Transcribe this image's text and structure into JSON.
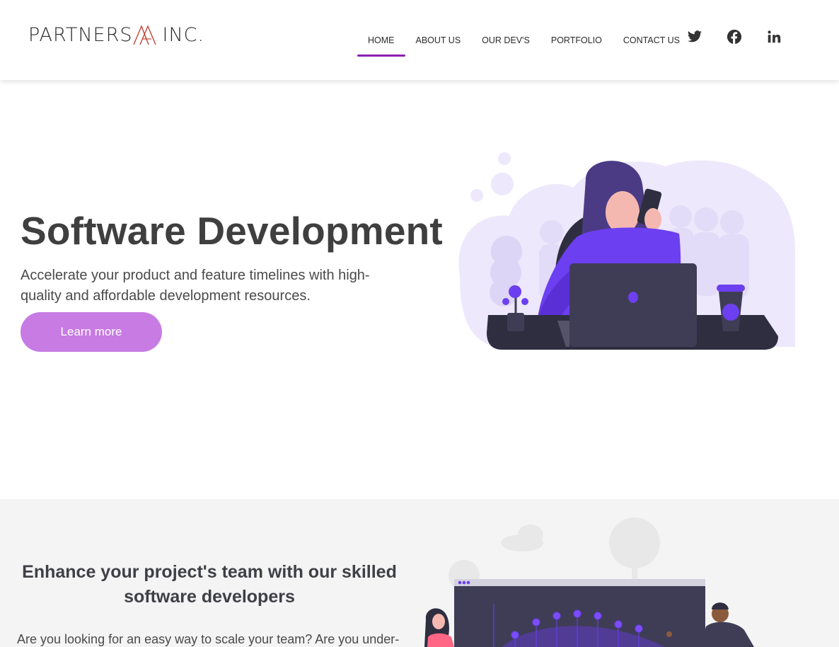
{
  "logo": {
    "left": "PARTNERS",
    "right": "INC."
  },
  "nav": {
    "items": [
      {
        "label": "HOME",
        "active": true
      },
      {
        "label": "ABOUT US",
        "active": false
      },
      {
        "label": "OUR DEV'S",
        "active": false
      },
      {
        "label": "PORTFOLIO",
        "active": false
      },
      {
        "label": "CONTACT US",
        "active": false
      }
    ],
    "social": [
      "twitter-icon",
      "facebook-icon",
      "linkedin-icon"
    ]
  },
  "hero": {
    "title": "Software Development",
    "subtitle": "Accelerate your product and feature timelines with high-quality and affordable development resources.",
    "button_label": "Learn more"
  },
  "section2": {
    "heading": "Enhance your project's team with our skilled software developers",
    "text": "Are you looking for an easy way to scale your team? Are you under-"
  },
  "colors": {
    "accent": "#8e1fb3",
    "button": "#c77be3",
    "illustration_purple": "#6c3ff0",
    "illustration_dark": "#3f3d56"
  }
}
